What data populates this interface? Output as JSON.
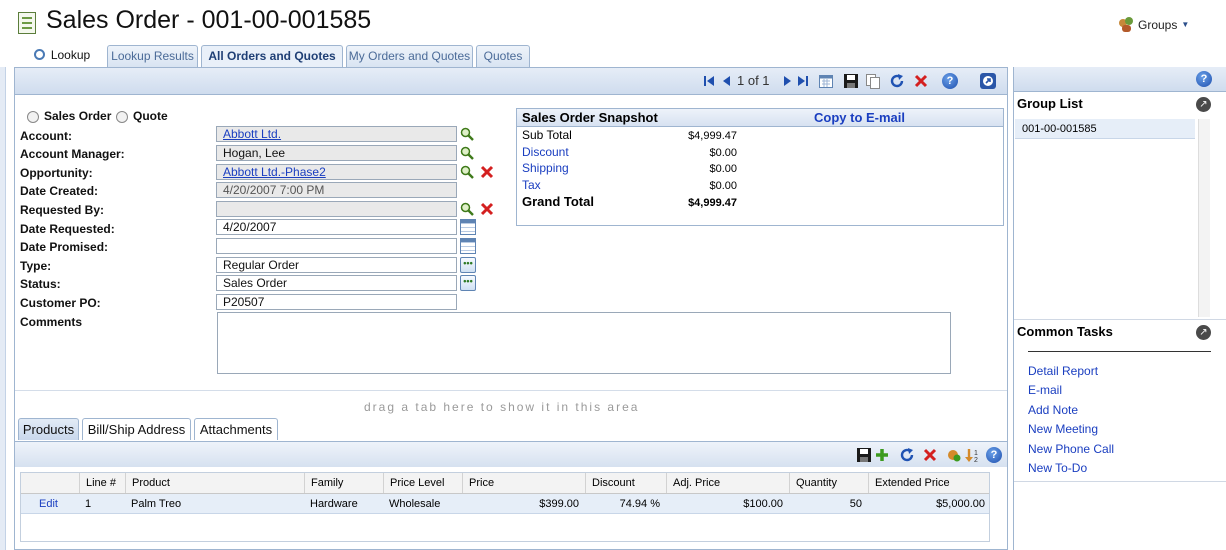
{
  "header": {
    "title": "Sales Order - 001-00-001585",
    "groups_label": "Groups"
  },
  "tabs": {
    "lookup": "Lookup",
    "lookup_results": "Lookup Results",
    "all_orders": "All Orders and Quotes",
    "my_orders": "My Orders and Quotes",
    "quotes": "Quotes"
  },
  "toolbar": {
    "pager": "1 of 1"
  },
  "form": {
    "radio_sales_order": "Sales Order",
    "radio_quote": "Quote",
    "labels": {
      "account": "Account:",
      "account_manager": "Account Manager:",
      "opportunity": "Opportunity:",
      "date_created": "Date Created:",
      "requested_by": "Requested By:",
      "date_requested": "Date Requested:",
      "date_promised": "Date Promised:",
      "type": "Type:",
      "status": "Status:",
      "customer_po": "Customer PO:",
      "comments": "Comments"
    },
    "values": {
      "account": "Abbott Ltd.",
      "account_manager": "Hogan, Lee",
      "opportunity": "Abbott Ltd.-Phase2",
      "date_created": "4/20/2007 7:00 PM",
      "requested_by": "",
      "date_requested": "4/20/2007",
      "date_promised": "",
      "type": "Regular Order",
      "status": "Sales Order",
      "customer_po": "P20507",
      "comments": ""
    }
  },
  "snapshot": {
    "title": "Sales Order Snapshot",
    "copy_link": "Copy to E-mail",
    "rows": [
      {
        "label": "Sub Total",
        "value": "$4,999.47"
      },
      {
        "label": "Discount",
        "value": "$0.00"
      },
      {
        "label": "Shipping",
        "value": "$0.00"
      },
      {
        "label": "Tax",
        "value": "$0.00"
      },
      {
        "label": "Grand Total",
        "value": "$4,999.47"
      }
    ]
  },
  "bottom": {
    "drag_hint": "drag a tab here to show it in this area",
    "tabs": [
      "Products",
      "Bill/Ship Address",
      "Attachments"
    ]
  },
  "products": {
    "columns": [
      "",
      "Line #",
      "Product",
      "Family",
      "Price Level",
      "Price",
      "Discount",
      "Adj. Price",
      "Quantity",
      "Extended Price"
    ],
    "rows": [
      {
        "edit": "Edit",
        "line": "1",
        "product": "Palm Treo",
        "family": "Hardware",
        "price_level": "Wholesale",
        "price": "$399.00",
        "discount": "74.94 %",
        "adj_price": "$100.00",
        "quantity": "50",
        "extended": "$5,000.00"
      }
    ]
  },
  "right_panel": {
    "group_list_title": "Group List",
    "group_items": [
      "001-00-001585"
    ],
    "common_tasks_title": "Common Tasks",
    "tasks": [
      "Detail Report",
      "E-mail",
      "Add Note",
      "New Meeting",
      "New Phone Call",
      "New To-Do"
    ]
  }
}
